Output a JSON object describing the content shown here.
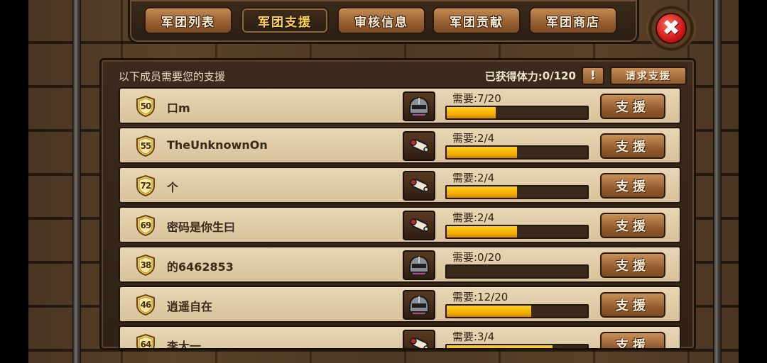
{
  "tabs": [
    {
      "label": "军团列表",
      "active": false
    },
    {
      "label": "军团支援",
      "active": true
    },
    {
      "label": "审核信息",
      "active": false
    },
    {
      "label": "军团贡献",
      "active": false
    },
    {
      "label": "军团商店",
      "active": false
    }
  ],
  "close_label": "✖",
  "header": {
    "prompt": "以下成员需要您的支援",
    "stamina_label": "已获得体力:",
    "stamina_value": "0/120",
    "info_label": "!",
    "request_label": "请求支援"
  },
  "members": [
    {
      "level": "50",
      "name": "口m",
      "item_icon": "helmet-icon",
      "need": "需要:7/20",
      "progress": 0.35,
      "button": "支援"
    },
    {
      "level": "55",
      "name": "TheUnknownOn",
      "item_icon": "scroll-icon",
      "need": "需要:2/4",
      "progress": 0.5,
      "button": "支援"
    },
    {
      "level": "72",
      "name": "个",
      "item_icon": "scroll-icon",
      "need": "需要:2/4",
      "progress": 0.5,
      "button": "支援"
    },
    {
      "level": "69",
      "name": "密码是你生曰",
      "item_icon": "scroll-icon",
      "need": "需要:2/4",
      "progress": 0.5,
      "button": "支援"
    },
    {
      "level": "38",
      "name": "的6462853",
      "item_icon": "helmet-icon",
      "need": "需要:0/20",
      "progress": 0.0,
      "button": "支援"
    },
    {
      "level": "46",
      "name": "逍遥自在",
      "item_icon": "helmet-icon",
      "need": "需要:12/20",
      "progress": 0.6,
      "button": "支援"
    },
    {
      "level": "64",
      "name": "李大一",
      "item_icon": "scroll-icon",
      "need": "需要:3/4",
      "progress": 0.75,
      "button": "支援"
    }
  ],
  "colors": {
    "progress_fill": "#f0a800",
    "tab_active_text": "#ffd24a",
    "close_red": "#d01818"
  }
}
